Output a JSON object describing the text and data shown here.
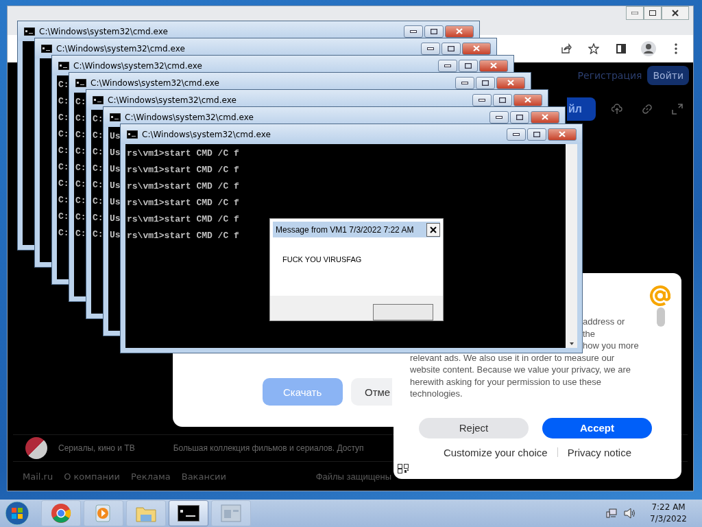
{
  "browser": {
    "header_link": "Регистрация",
    "login_button": "Войти",
    "download_button": "йл",
    "dialog": {
      "buttons": [
        {
          "label": "Скачать",
          "kind": "primary"
        },
        {
          "label": "Отме",
          "kind": "secondary"
        }
      ]
    },
    "promo": {
      "title": "Сериалы, кино и ТВ",
      "description": "Большая коллекция фильмов и сериалов. Доступ"
    },
    "footer": {
      "links": [
        "Mail.ru",
        "О компании",
        "Реклама",
        "Вакансии"
      ],
      "notice": "Файлы защищены"
    }
  },
  "cookie_panel": {
    "text_fragments": [
      "address or",
      "the",
      "how you more"
    ],
    "text": "relevant ads. We also use it in order to measure our website content. Because we value your privacy, we are herewith asking for your permission to use these technologies.",
    "buttons": [
      {
        "label": "Reject",
        "kind": "secondary"
      },
      {
        "label": "Accept",
        "kind": "primary"
      }
    ],
    "links": [
      "Customize your choice",
      "Privacy notice"
    ]
  },
  "cmd_windows": [
    {
      "title": "C:\\Windows\\system32\\cmd.exe"
    },
    {
      "title": "C:\\Windows\\system32\\cmd.exe"
    },
    {
      "title": "C:\\Windows\\system32\\cmd.exe",
      "lines": [
        "C:",
        "C:",
        "C:",
        "C:",
        "C:",
        "C:",
        "C:",
        "C:",
        "C:",
        "C:"
      ]
    },
    {
      "title": "C:\\Windows\\system32\\cmd.exe",
      "lines": [
        "C:",
        "C:",
        "C:",
        "C:",
        "C:",
        "C:",
        "C:",
        "C:",
        "C:"
      ]
    },
    {
      "title": "C:\\Windows\\system32\\cmd.exe",
      "lines": [
        "C:",
        "C:",
        "C:",
        "C:",
        "C:",
        "C:",
        "C:",
        "C:"
      ]
    },
    {
      "title": "C:\\Windows\\system32\\cmd.exe",
      "lines": [
        "Us",
        "Us",
        "Us",
        "Us",
        "Us",
        "Us",
        "Us"
      ]
    },
    {
      "title": "C:\\Windows\\system32\\cmd.exe",
      "lines": [
        "rs\\vm1>start CMD /C f",
        "rs\\vm1>start CMD /C f",
        "rs\\vm1>start CMD /C f",
        "rs\\vm1>start CMD /C f",
        "rs\\vm1>start CMD /C f",
        "rs\\vm1>start CMD /C f"
      ]
    }
  ],
  "message_box": {
    "title": "Message from VM1 7/3/2022 7:22 AM",
    "message": "FUCK YOU VIRUSFAG"
  },
  "taskbar": {
    "apps": [
      {
        "kind": "chrome",
        "selected": false
      },
      {
        "kind": "media",
        "selected": false
      },
      {
        "kind": "explorer",
        "selected": false
      },
      {
        "kind": "cmd",
        "selected": true
      },
      {
        "kind": "window",
        "selected": false
      }
    ],
    "clock": {
      "time": "7:22 AM",
      "date": "7/3/2022"
    }
  }
}
